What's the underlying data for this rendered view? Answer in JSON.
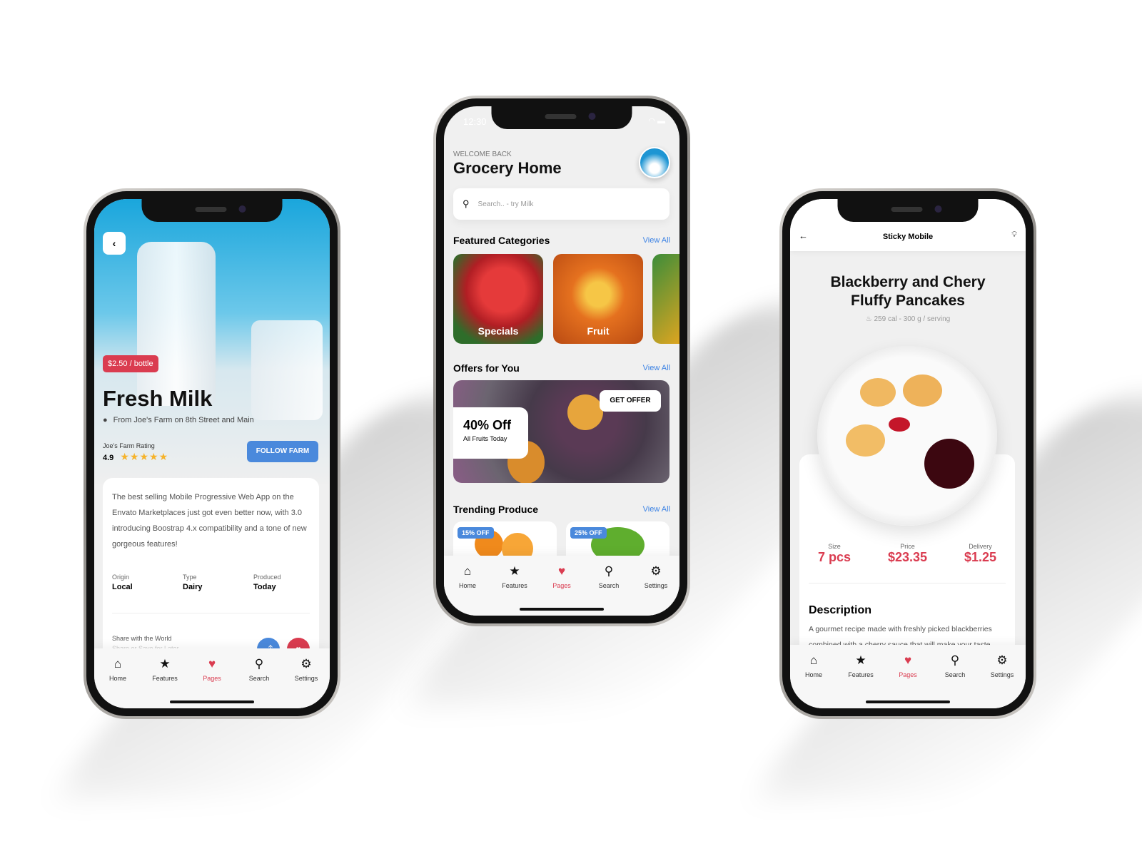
{
  "colors": {
    "accent_red": "#da3c50",
    "accent_blue": "#4a89dc",
    "star": "#f6b32b"
  },
  "nav": [
    {
      "icon": "home-icon",
      "glyph": "⌂",
      "label": "Home"
    },
    {
      "icon": "star-icon",
      "glyph": "★",
      "label": "Features"
    },
    {
      "icon": "heart-icon",
      "glyph": "♥",
      "label": "Pages",
      "active": true
    },
    {
      "icon": "search-icon",
      "glyph": "⚲",
      "label": "Search"
    },
    {
      "icon": "gear-icon",
      "glyph": "⚙",
      "label": "Settings"
    }
  ],
  "left": {
    "price": "$2.50 / bottle",
    "title": "Fresh Milk",
    "location": "From Joe's Farm on 8th Street and Main",
    "rating_label": "Joe's Farm Rating",
    "rating": "4.9",
    "stars": 5,
    "follow": "FOLLOW FARM",
    "description": "The best selling Mobile Progressive Web App on the Envato Marketplaces just got even better now, with 3.0 introducing Boostrap 4.x compatibility and a tone of new gorgeous features!",
    "facts": [
      {
        "label": "Origin",
        "value": "Local"
      },
      {
        "label": "Type",
        "value": "Dairy"
      },
      {
        "label": "Produced",
        "value": "Today"
      }
    ],
    "share_label": "Share with the World",
    "share_sub": "Share or Save for Later"
  },
  "center": {
    "time": "12:30",
    "welcome": "WELCOME BACK",
    "title": "Grocery Home",
    "search_placeholder": "Search.. - try Milk",
    "featured": "Featured Categories",
    "view_all": "View All",
    "categories": [
      "Specials",
      "Fruit",
      ""
    ],
    "offers": "Offers for You",
    "offer_title": "40% Off",
    "offer_sub": "All Fruits Today",
    "get_offer": "GET OFFER",
    "trending": "Trending Produce",
    "trending_badges": [
      "15% OFF",
      "25% OFF"
    ]
  },
  "right": {
    "header": "Sticky Mobile",
    "title_line1": "Blackberry and Chery",
    "title_line2": "Fluffy Pancakes",
    "meta": "259 cal - 300 g / serving",
    "stats": [
      {
        "label": "Size",
        "value": "7 pcs"
      },
      {
        "label": "Price",
        "value": "$23.35"
      },
      {
        "label": "Delivery",
        "value": "$1.25"
      }
    ],
    "desc_title": "Description",
    "desc": "A gourmet recipe made with freshly picked blackberries combined with a cherry sauce that will make your taste buds feel incredible"
  }
}
